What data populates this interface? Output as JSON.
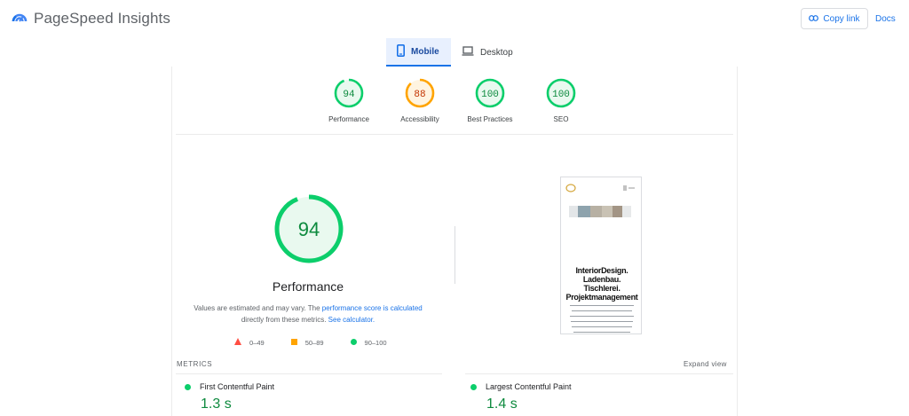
{
  "app": {
    "title": "PageSpeed Insights"
  },
  "header": {
    "copy_link_label": "Copy link",
    "docs_label": "Docs"
  },
  "device_tabs": [
    {
      "label": "Mobile",
      "selected": true
    },
    {
      "label": "Desktop",
      "selected": false
    }
  ],
  "categories": [
    {
      "label": "Performance",
      "score": 94,
      "status": "pass",
      "color": "#0cce6b"
    },
    {
      "label": "Accessibility",
      "score": 88,
      "status": "average",
      "color": "#ffa400"
    },
    {
      "label": "Best Practices",
      "score": 100,
      "status": "pass",
      "color": "#0cce6b"
    },
    {
      "label": "SEO",
      "score": 100,
      "status": "pass",
      "color": "#0cce6b"
    }
  ],
  "performance": {
    "score": 94,
    "title": "Performance",
    "desc_part1": "Values are estimated and may vary. The ",
    "desc_link1": "performance score is calculated",
    "desc_part2": " directly from these metrics. ",
    "desc_link2": "See calculator.",
    "legend": [
      {
        "icon": "red-triangle-icon",
        "range": "0–49",
        "color": "#ff4e42"
      },
      {
        "icon": "orange-square-icon",
        "range": "50–89",
        "color": "#ffa400"
      },
      {
        "icon": "green-circle-icon",
        "range": "90–100",
        "color": "#0cce6b"
      }
    ]
  },
  "preview": {
    "headline_lines": [
      "InteriorDesign.",
      "Ladenbau.",
      "Tischlerei.",
      "Projektmanagement"
    ]
  },
  "metrics": {
    "section_label": "METRICS",
    "expand_label": "Expand view",
    "items": [
      {
        "name": "First Contentful Paint",
        "value": "1.3 s"
      },
      {
        "name": "Largest Contentful Paint",
        "value": "1.4 s"
      }
    ]
  },
  "colors": {
    "accent": "#1a73e8",
    "pass": "#0cce6b",
    "average": "#ffa400",
    "fail": "#ff4e42"
  }
}
